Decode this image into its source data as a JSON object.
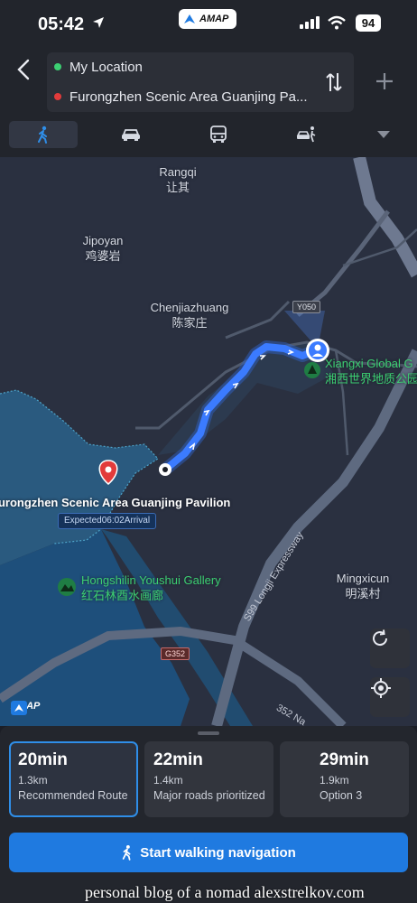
{
  "status_bar": {
    "time": "05:42",
    "battery": "94",
    "app_badge": "AMAP"
  },
  "route": {
    "origin": "My Location",
    "destination": "Furongzhen Scenic Area Guanjing Pa...",
    "colors": {
      "origin_dot": "#3ccf72",
      "destination_dot": "#e23b3b",
      "accent": "#1f7ae0"
    }
  },
  "modes": [
    {
      "icon": "walk-icon",
      "active": true
    },
    {
      "icon": "car-icon",
      "active": false
    },
    {
      "icon": "bus-icon",
      "active": false
    },
    {
      "icon": "taxi-icon",
      "active": false
    }
  ],
  "map": {
    "places": {
      "rangqi_en": "Rangqi",
      "rangqi_zh": "让其",
      "jipoyan_en": "Jipoyan",
      "jipoyan_zh": "鸡婆岩",
      "chenjia_en": "Chenjiazhuang",
      "chenjia_zh": "陈家庄",
      "xiangxi_en": "Xiangxi Global G",
      "xiangxi_zh": "湘西世界地质公园",
      "gallery_en": "Hongshilin Youshui Gallery",
      "gallery_zh": "红石林酉水画廊",
      "mingxi_en": "Mingxicun",
      "mingxi_zh": "明溪村"
    },
    "destination_label": "Furongzhen Scenic Area Guanjing Pavilion",
    "eta_tag": "Expected06:02Arrival",
    "road_tags": {
      "y050": "Y050",
      "g352": "G352"
    },
    "road_names": {
      "expressway": "S99 Longji Expressway",
      "road_352": "352 Na"
    },
    "logo": "AMAP"
  },
  "options": [
    {
      "duration": "20min",
      "distance": "1.3km",
      "tag": "Recommended Route",
      "selected": true
    },
    {
      "duration": "22min",
      "distance": "1.4km",
      "tag": "Major roads prioritized",
      "selected": false
    },
    {
      "duration": "29min",
      "distance": "1.9km",
      "tag": "Option 3",
      "selected": false
    }
  ],
  "start_button": "Start walking navigation",
  "watermark": "personal blog of a nomad alexstrelkov.com"
}
